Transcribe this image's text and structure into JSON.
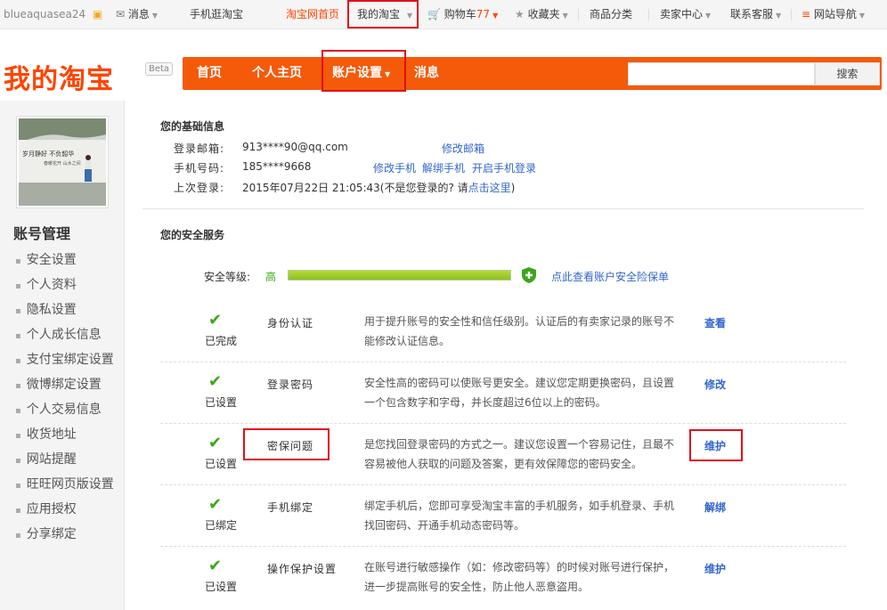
{
  "topbar": {
    "username": "blueaquasea24",
    "messages": "消息",
    "mobile": "手机逛淘宝",
    "home": "淘宝网首页",
    "my_taobao": "我的淘宝",
    "cart": "购物车77",
    "favorites": "收藏夹",
    "categories": "商品分类",
    "seller_center": "卖家中心",
    "support": "联系客服",
    "site_nav": "网站导航"
  },
  "header": {
    "logo": "我的淘宝",
    "beta": "Beta",
    "nav": [
      "首页",
      "个人主页",
      "账户设置",
      "消息"
    ],
    "search_button": "搜索",
    "search_placeholder": ""
  },
  "sidebar": {
    "title": "账号管理",
    "items": [
      "安全设置",
      "个人资料",
      "隐私设置",
      "个人成长信息",
      "支付宝绑定设置",
      "微博绑定设置",
      "个人交易信息",
      "收货地址",
      "网站提醒",
      "旺旺网页版设置",
      "应用授权",
      "分享绑定"
    ]
  },
  "basic_info": {
    "title": "您的基础信息",
    "email_label": "登录邮箱:",
    "email": "913****90@qq.com",
    "email_link": "修改邮箱",
    "phone_label": "手机号码:",
    "phone": "185****9668",
    "phone_links": [
      "修改手机",
      "解绑手机",
      "开启手机登录"
    ],
    "last_login_label": "上次登录:",
    "last_login": "2015年07月22日 21:05:43(不是您登录的? 请",
    "last_login_link": "点击这里",
    "last_login_end": ")"
  },
  "security": {
    "title": "您的安全服务",
    "level_label": "安全等级:",
    "level": "高",
    "level_fraction": 1.0,
    "insurance_link": "点此查看账户安全险保单",
    "services": [
      {
        "status": "已完成",
        "name": "身份认证",
        "desc": "用于提升账号的安全性和信任级别。认证后的有卖家记录的账号不能修改认证信息。",
        "action": "查看"
      },
      {
        "status": "已设置",
        "name": "登录密码",
        "desc": "安全性高的密码可以使账号更安全。建议您定期更换密码，且设置一个包含数字和字母，并长度超过6位以上的密码。",
        "action": "修改"
      },
      {
        "status": "已设置",
        "name": "密保问题",
        "desc": "是您找回登录密码的方式之一。建议您设置一个容易记住，且最不容易被他人获取的问题及答案，更有效保障您的密码安全。",
        "action": "维护"
      },
      {
        "status": "已绑定",
        "name": "手机绑定",
        "desc": "绑定手机后，您即可享受淘宝丰富的手机服务，如手机登录、手机找回密码、开通手机动态密码等。",
        "action": "解绑"
      },
      {
        "status": "已设置",
        "name": "操作保护设置",
        "desc": "在账号进行敏感操作（如：修改密码等）的时候对账号进行保护，进一步提高账号的安全性，防止他人恶意盗用。",
        "action": "维护"
      }
    ]
  },
  "colors": {
    "accent": "#f45a0a",
    "link": "#3366cc",
    "check": "#39a713",
    "highlight": "#e0101a"
  }
}
